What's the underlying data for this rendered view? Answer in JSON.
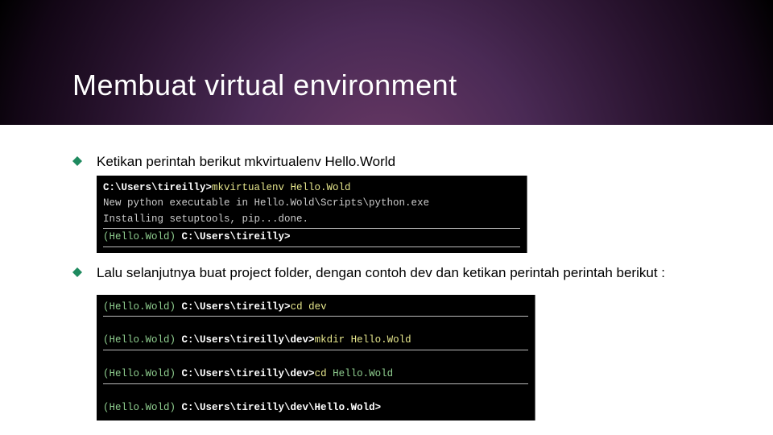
{
  "title": "Membuat virtual environment",
  "bullets": [
    "Ketikan perintah berikut mkvirtualenv Hello.World",
    "Lalu selanjutnya buat project folder, dengan contoh dev dan ketikan perintah perintah berikut :"
  ],
  "terminal1": {
    "line1_prefix": "C:\\Users\\tireilly>",
    "line1_cmd": "mkvirtualenv Hello.Wold",
    "line2": "New python executable in Hello.Wold\\Scripts\\python.exe",
    "line3": "Installing setuptools, pip...done.",
    "line4_env": "(Hello.Wold) ",
    "line4_path": "C:\\Users\\tireilly>"
  },
  "terminal2": {
    "env": "(Hello.Wold) ",
    "l1_path": "C:\\Users\\tireilly>",
    "l1_cmd": "cd dev",
    "l2_path": "C:\\Users\\tireilly\\dev>",
    "l2_cmd": "mkdir Hello.Wold",
    "l3_path": "C:\\Users\\tireilly\\dev>",
    "l3_cmd_a": "cd ",
    "l3_cmd_b": "Hello.Wold",
    "l4_path": "C:\\Users\\tireilly\\dev\\Hello.Wold>"
  },
  "colors": {
    "accent": "#1f8a5f"
  }
}
